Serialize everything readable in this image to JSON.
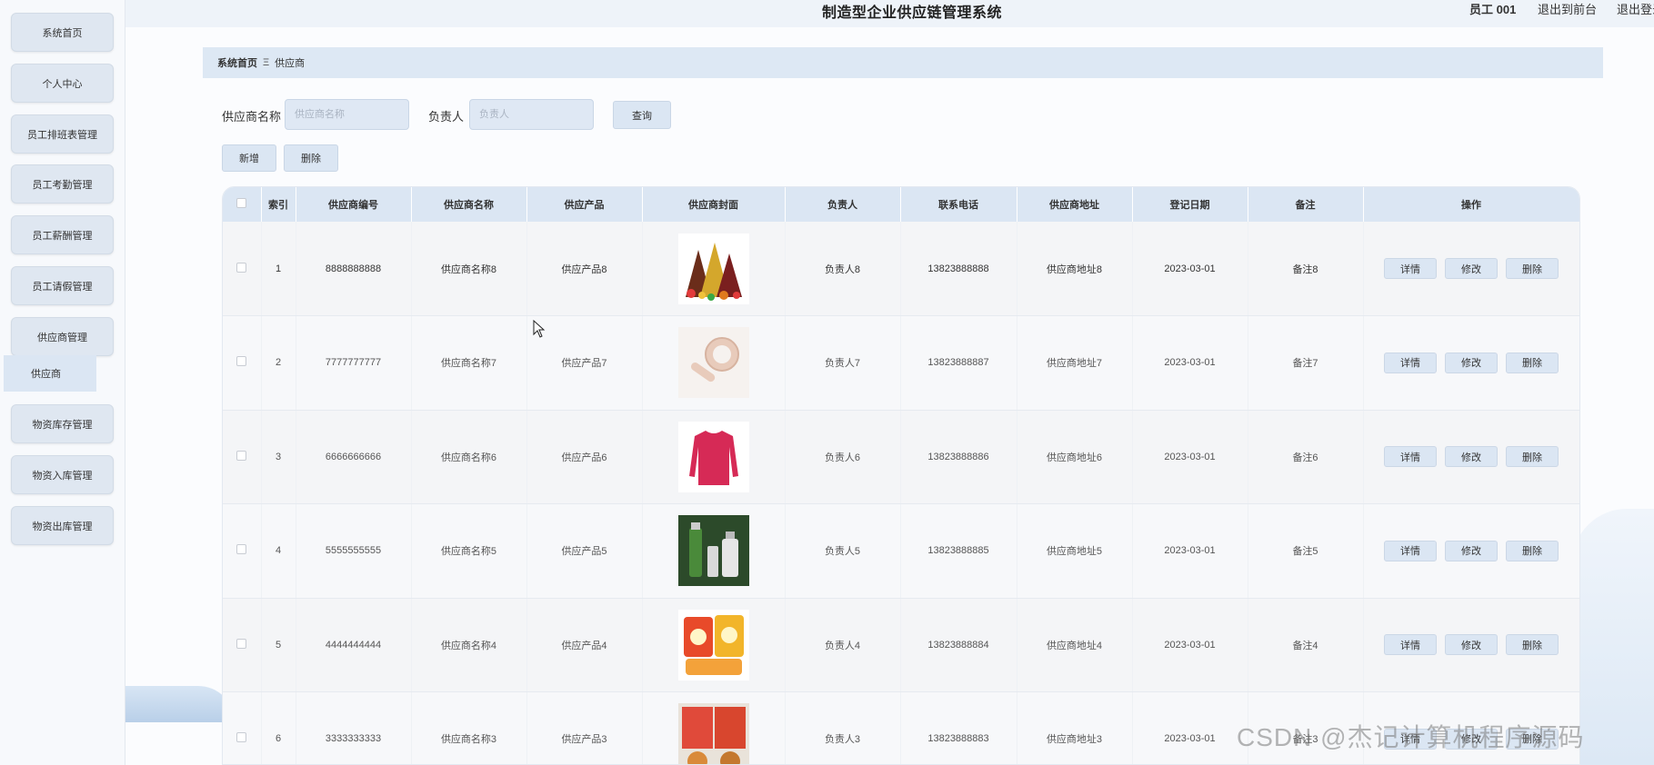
{
  "header": {
    "title": "制造型企业供应链管理系统",
    "user": "员工 001",
    "link_front": "退出到前台",
    "link_logout": "退出登录"
  },
  "sidebar": {
    "items": [
      {
        "label": "系统首页"
      },
      {
        "label": "个人中心"
      },
      {
        "label": "员工排班表管理"
      },
      {
        "label": "员工考勤管理"
      },
      {
        "label": "员工薪酬管理"
      },
      {
        "label": "员工请假管理"
      },
      {
        "label": "供应商管理"
      },
      {
        "label": "物资库存管理"
      },
      {
        "label": "物资入库管理"
      },
      {
        "label": "物资出库管理"
      }
    ],
    "submenu": {
      "label": "供应商"
    }
  },
  "breadcrumb": {
    "home": "系统首页",
    "separator": "Ξ",
    "current": "供应商"
  },
  "search": {
    "name_label": "供应商名称",
    "name_placeholder": "供应商名称",
    "person_label": "负责人",
    "person_placeholder": "负责人",
    "query_label": "查询"
  },
  "actions": {
    "add_label": "新增",
    "delete_label": "删除"
  },
  "table": {
    "headers": [
      "索引",
      "供应商编号",
      "供应商名称",
      "供应产品",
      "供应商封面",
      "负责人",
      "联系电话",
      "供应商地址",
      "登记日期",
      "备注",
      "操作"
    ],
    "op_labels": {
      "detail": "详情",
      "edit": "修改",
      "delete": "删除"
    },
    "rows": [
      {
        "index": "1",
        "code": "8888888888",
        "name": "供应商名称8",
        "product": "供应产品8",
        "cover": "chocolate-cover",
        "person": "负责人8",
        "phone": "13823888888",
        "address": "供应商地址8",
        "date": "2023-03-01",
        "note": "备注8"
      },
      {
        "index": "2",
        "code": "7777777777",
        "name": "供应商名称7",
        "product": "供应产品7",
        "cover": "egg-separator-cover",
        "person": "负责人7",
        "phone": "13823888887",
        "address": "供应商地址7",
        "date": "2023-03-01",
        "note": "备注7"
      },
      {
        "index": "3",
        "code": "6666666666",
        "name": "供应商名称6",
        "product": "供应产品6",
        "cover": "red-sweater-cover",
        "person": "负责人6",
        "phone": "13823888886",
        "address": "供应商地址6",
        "date": "2023-03-01",
        "note": "备注6"
      },
      {
        "index": "4",
        "code": "5555555555",
        "name": "供应商名称5",
        "product": "供应产品5",
        "cover": "cosmetics-cover",
        "person": "负责人5",
        "phone": "13823888885",
        "address": "供应商地址5",
        "date": "2023-03-01",
        "note": "备注5"
      },
      {
        "index": "5",
        "code": "4444444444",
        "name": "供应商名称4",
        "product": "供应产品4",
        "cover": "snack-cover",
        "person": "负责人4",
        "phone": "13823888884",
        "address": "供应商地址4",
        "date": "2023-03-01",
        "note": "备注4"
      },
      {
        "index": "6",
        "code": "3333333333",
        "name": "供应商名称3",
        "product": "供应产品3",
        "cover": "food-pack-cover",
        "person": "负责人3",
        "phone": "13823888883",
        "address": "供应商地址3",
        "date": "2023-03-01",
        "note": "备注3"
      }
    ]
  },
  "watermark": "CSDN @杰记计算机程序源码",
  "colors": {
    "accent": "#dbe6f3",
    "header_bg": "#eef3f9",
    "breadcrumb_bg": "#dde8f4"
  }
}
